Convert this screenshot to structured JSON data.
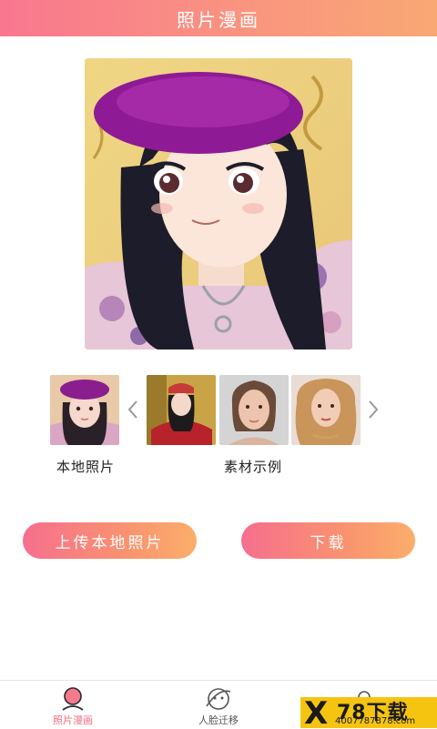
{
  "header": {
    "title": "照片漫画"
  },
  "preview": {
    "icon": "anime-portrait-image"
  },
  "gallery": {
    "local_label": "本地照片",
    "sample_label": "素材示例",
    "prev_icon": "chevron-left-icon",
    "next_icon": "chevron-right-icon"
  },
  "actions": {
    "upload_label": "上传本地照片",
    "download_label": "下载"
  },
  "tabbar": {
    "items": [
      {
        "label": "照片漫画",
        "icon": "portrait-icon",
        "active": true
      },
      {
        "label": "人脸迁移",
        "icon": "face-swap-icon",
        "active": false
      },
      {
        "label": "",
        "icon": "profile-icon",
        "active": false
      }
    ]
  },
  "watermark": {
    "brand": "78下载",
    "mark": "X",
    "url": "4007787878.com"
  },
  "colors": {
    "accent": "#f87b8a",
    "accent_end": "#fbae6b",
    "active_tab": "#f26d7f"
  }
}
